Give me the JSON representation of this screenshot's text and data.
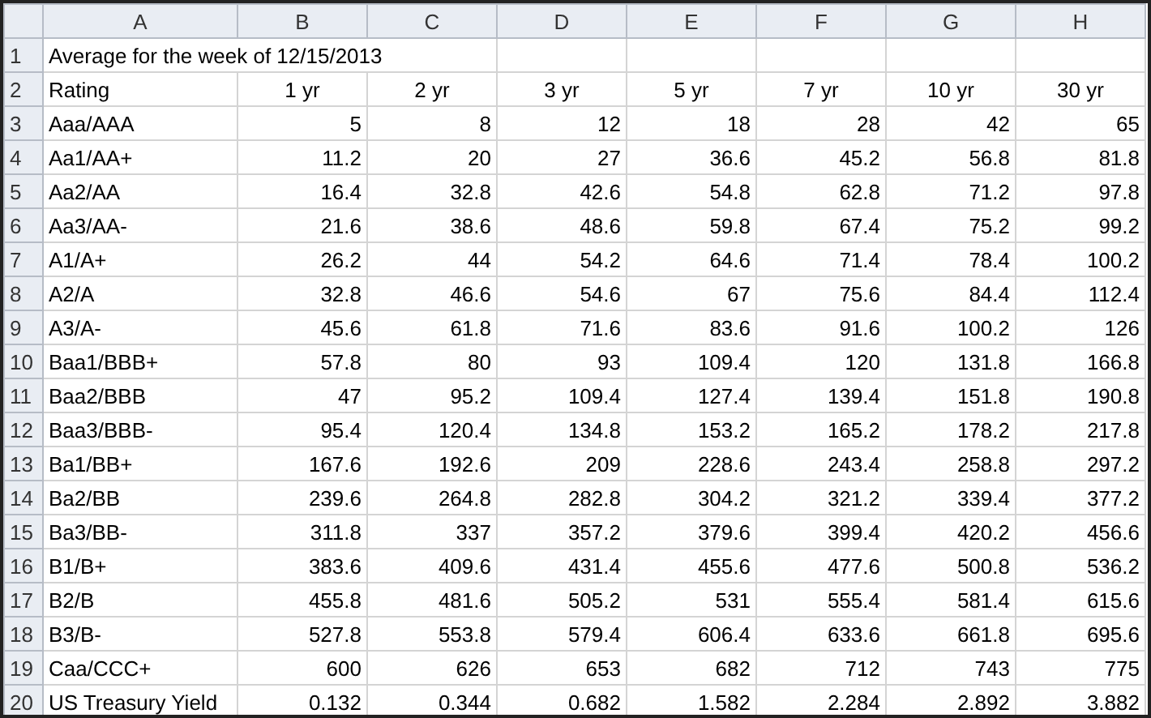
{
  "column_headers": [
    "A",
    "B",
    "C",
    "D",
    "E",
    "F",
    "G",
    "H"
  ],
  "rows": [
    {
      "row_number": "1",
      "kind": "title",
      "cells": [
        "Average for the week of 12/15/2013"
      ]
    },
    {
      "row_number": "2",
      "kind": "header",
      "cells": [
        "Rating",
        "1 yr",
        "2 yr",
        "3 yr",
        "5 yr",
        "7 yr",
        "10 yr",
        "30 yr"
      ]
    },
    {
      "row_number": "3",
      "kind": "data",
      "cells": [
        "Aaa/AAA",
        "5",
        "8",
        "12",
        "18",
        "28",
        "42",
        "65"
      ]
    },
    {
      "row_number": "4",
      "kind": "data",
      "cells": [
        "Aa1/AA+",
        "11.2",
        "20",
        "27",
        "36.6",
        "45.2",
        "56.8",
        "81.8"
      ]
    },
    {
      "row_number": "5",
      "kind": "data",
      "cells": [
        "Aa2/AA",
        "16.4",
        "32.8",
        "42.6",
        "54.8",
        "62.8",
        "71.2",
        "97.8"
      ]
    },
    {
      "row_number": "6",
      "kind": "data",
      "cells": [
        "Aa3/AA-",
        "21.6",
        "38.6",
        "48.6",
        "59.8",
        "67.4",
        "75.2",
        "99.2"
      ]
    },
    {
      "row_number": "7",
      "kind": "data",
      "cells": [
        "A1/A+",
        "26.2",
        "44",
        "54.2",
        "64.6",
        "71.4",
        "78.4",
        "100.2"
      ]
    },
    {
      "row_number": "8",
      "kind": "data",
      "cells": [
        "A2/A",
        "32.8",
        "46.6",
        "54.6",
        "67",
        "75.6",
        "84.4",
        "112.4"
      ]
    },
    {
      "row_number": "9",
      "kind": "data",
      "cells": [
        "A3/A-",
        "45.6",
        "61.8",
        "71.6",
        "83.6",
        "91.6",
        "100.2",
        "126"
      ]
    },
    {
      "row_number": "10",
      "kind": "data",
      "cells": [
        "Baa1/BBB+",
        "57.8",
        "80",
        "93",
        "109.4",
        "120",
        "131.8",
        "166.8"
      ]
    },
    {
      "row_number": "11",
      "kind": "data",
      "cells": [
        "Baa2/BBB",
        "47",
        "95.2",
        "109.4",
        "127.4",
        "139.4",
        "151.8",
        "190.8"
      ]
    },
    {
      "row_number": "12",
      "kind": "data",
      "cells": [
        "Baa3/BBB-",
        "95.4",
        "120.4",
        "134.8",
        "153.2",
        "165.2",
        "178.2",
        "217.8"
      ]
    },
    {
      "row_number": "13",
      "kind": "data",
      "cells": [
        "Ba1/BB+",
        "167.6",
        "192.6",
        "209",
        "228.6",
        "243.4",
        "258.8",
        "297.2"
      ]
    },
    {
      "row_number": "14",
      "kind": "data",
      "cells": [
        "Ba2/BB",
        "239.6",
        "264.8",
        "282.8",
        "304.2",
        "321.2",
        "339.4",
        "377.2"
      ]
    },
    {
      "row_number": "15",
      "kind": "data",
      "cells": [
        "Ba3/BB-",
        "311.8",
        "337",
        "357.2",
        "379.6",
        "399.4",
        "420.2",
        "456.6"
      ]
    },
    {
      "row_number": "16",
      "kind": "data",
      "cells": [
        "B1/B+",
        "383.6",
        "409.6",
        "431.4",
        "455.6",
        "477.6",
        "500.8",
        "536.2"
      ]
    },
    {
      "row_number": "17",
      "kind": "data",
      "cells": [
        "B2/B",
        "455.8",
        "481.6",
        "505.2",
        "531",
        "555.4",
        "581.4",
        "615.6"
      ]
    },
    {
      "row_number": "18",
      "kind": "data",
      "cells": [
        "B3/B-",
        "527.8",
        "553.8",
        "579.4",
        "606.4",
        "633.6",
        "661.8",
        "695.6"
      ]
    },
    {
      "row_number": "19",
      "kind": "data",
      "cells": [
        "Caa/CCC+",
        "600",
        "626",
        "653",
        "682",
        "712",
        "743",
        "775"
      ]
    },
    {
      "row_number": "20",
      "kind": "data",
      "cells": [
        "US Treasury Yield",
        "0.132",
        "0.344",
        "0.682",
        "1.582",
        "2.284",
        "2.892",
        "3.882"
      ]
    }
  ]
}
